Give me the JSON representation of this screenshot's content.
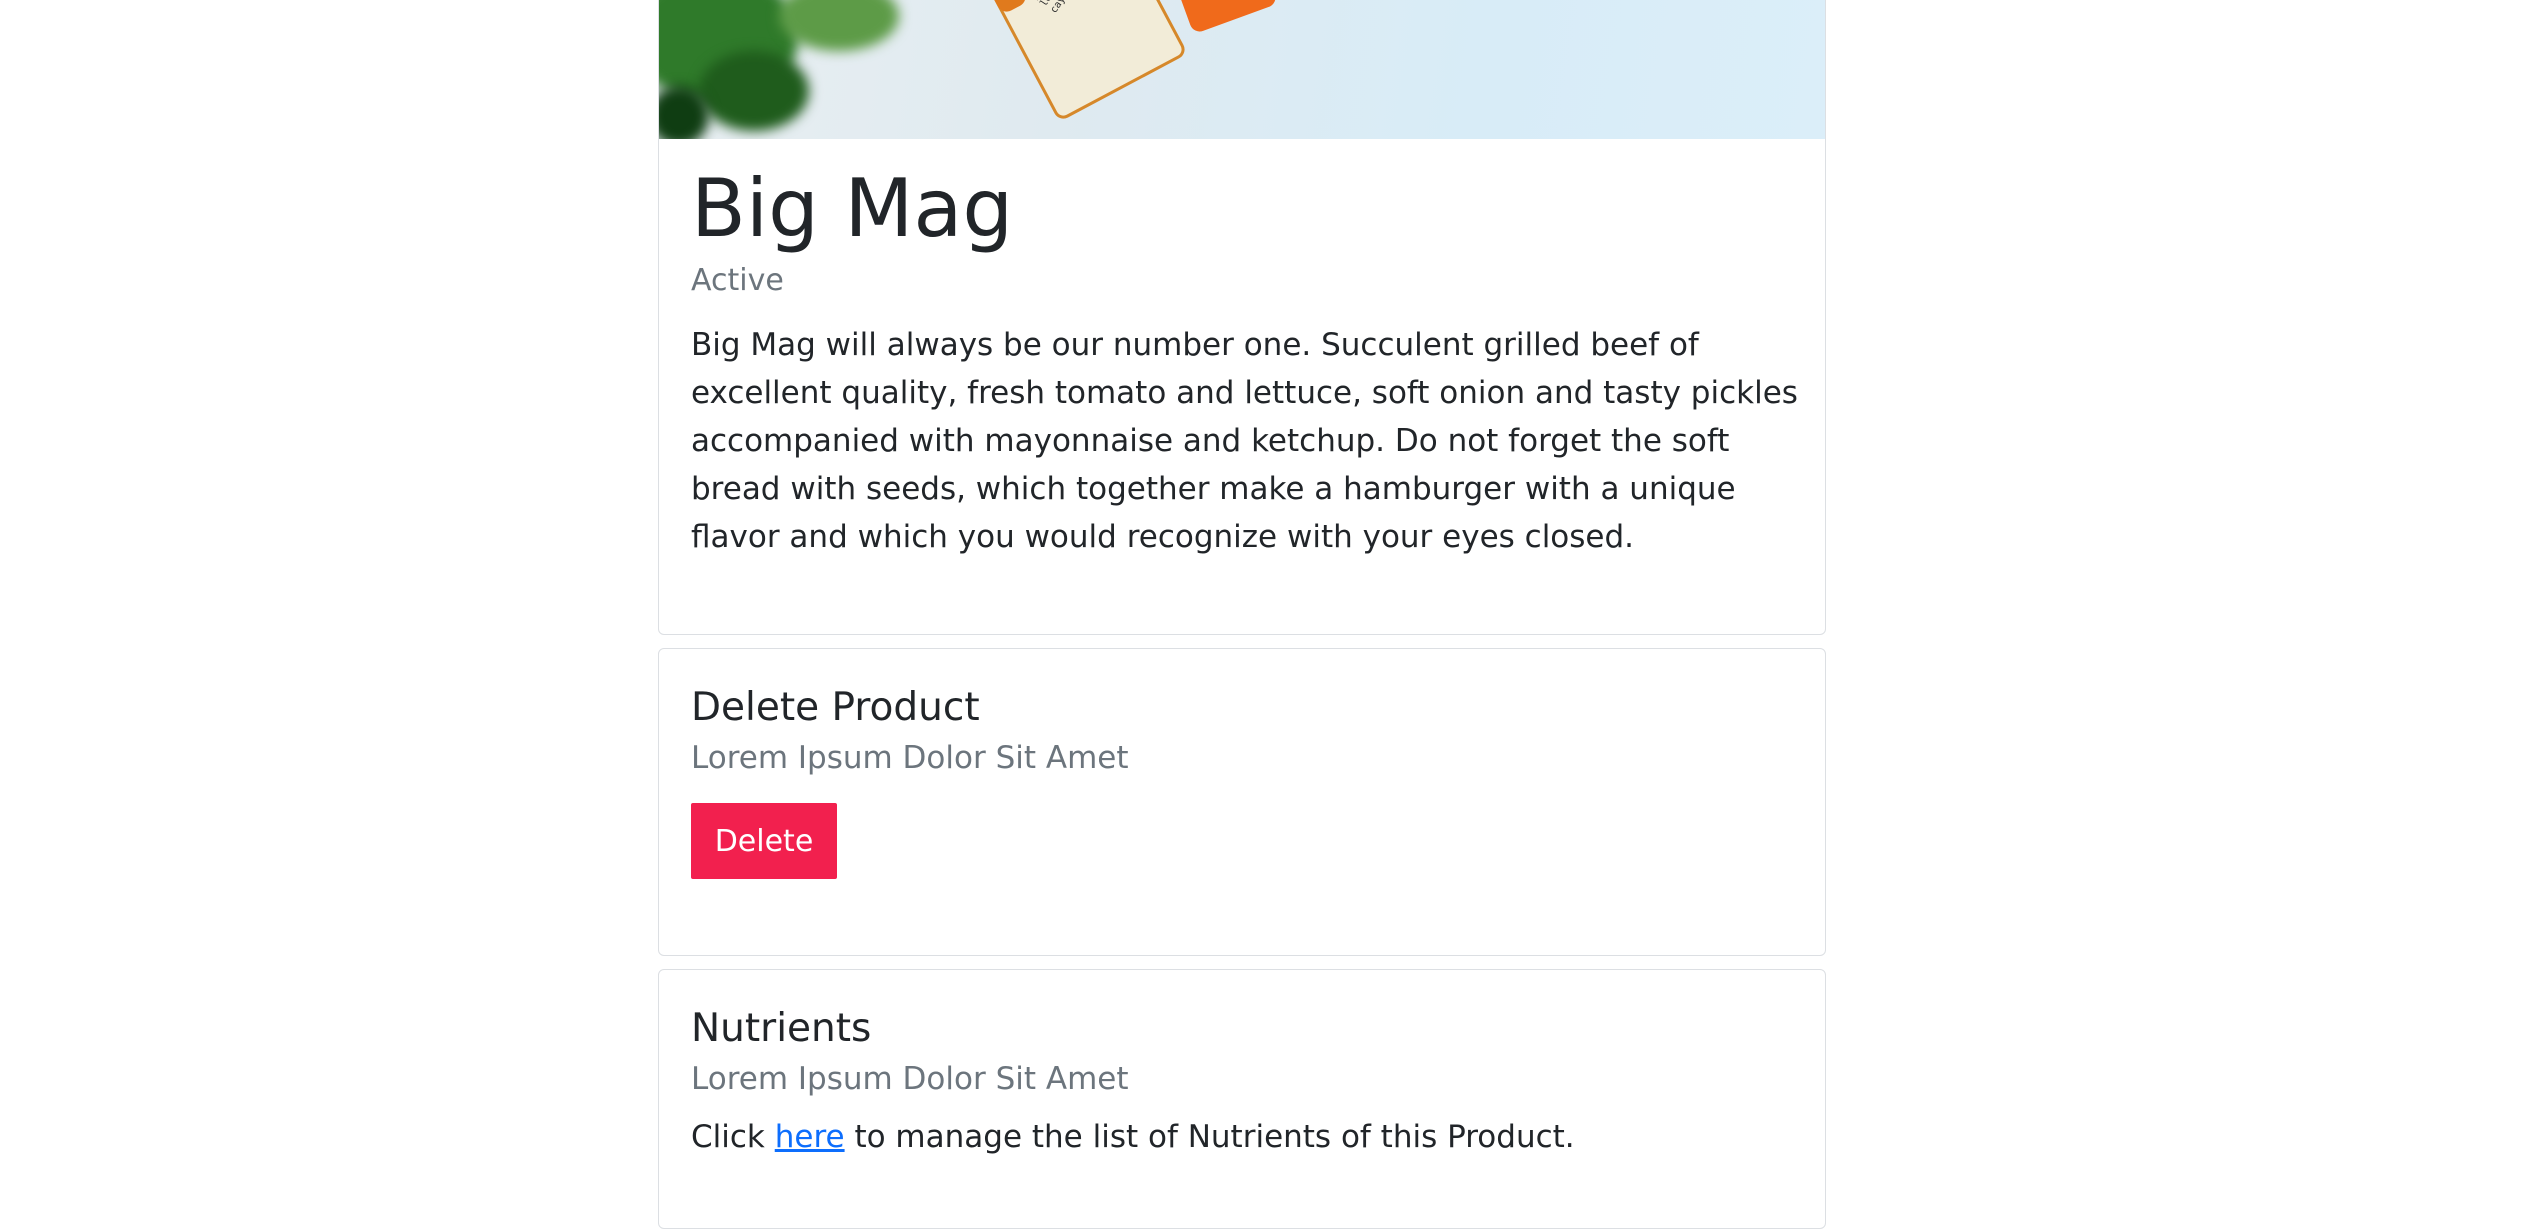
{
  "product": {
    "hero_alt": "Juice bottles on a table",
    "bottle_label_text": "well\nshot\nginger\nlemon\ncayenne",
    "title": "Big Mag",
    "status": "Active",
    "description": "Big Mag will always be our number one. Succulent grilled beef of excellent quality, fresh tomato and lettuce, soft onion and tasty pickles accompanied with mayonnaise and ketchup. Do not forget the soft bread with seeds, which together make a hamburger with a unique flavor and which you would recognize with your eyes closed."
  },
  "delete_section": {
    "title": "Delete Product",
    "subtitle": "Lorem Ipsum Dolor Sit Amet",
    "button_label": "Delete",
    "button_color": "#f2204e"
  },
  "nutrients_section": {
    "title": "Nutrients",
    "subtitle": "Lorem Ipsum Dolor Sit Amet",
    "text_before": "Click ",
    "link_label": "here",
    "text_after": " to manage the list of Nutrients of this Product.",
    "link_color": "#0d6efd"
  }
}
